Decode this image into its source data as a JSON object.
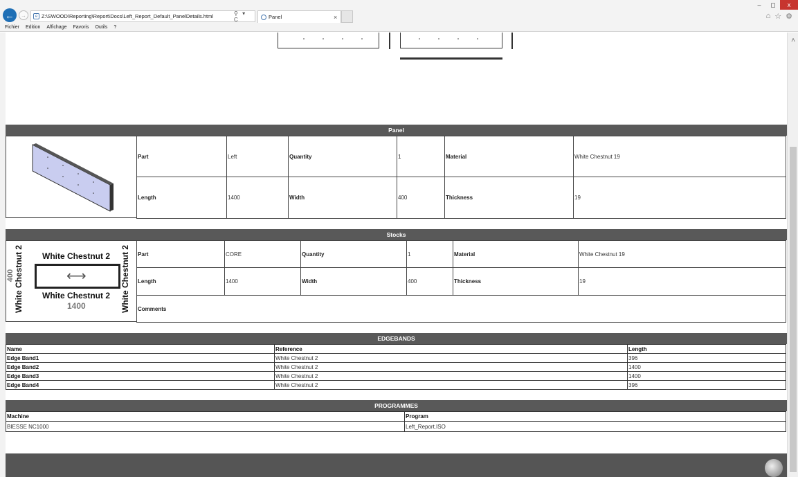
{
  "browser": {
    "url": "Z:\\SWOOD\\Reporting\\Report\\Docs\\Left_Report_Default_PanelDetails.html",
    "address_tools": "⚲ ▾ C",
    "tab_title": "Panel",
    "tab_close": "×",
    "window_controls": [
      "–",
      "◻",
      "x"
    ],
    "toolbar_icons": [
      "⌂",
      "☆",
      "⚙"
    ]
  },
  "menu": [
    "Fichier",
    "Edition",
    "Affichage",
    "Favoris",
    "Outils",
    "?"
  ],
  "panel": {
    "header": "Panel",
    "rows": [
      {
        "l1": "Part",
        "v1": "Left",
        "l2": "Quantity",
        "v2": "1",
        "l3": "Material",
        "v3": "White Chestnut 19"
      },
      {
        "l1": "Length",
        "v1": "1400",
        "l2": "Width",
        "v2": "400",
        "l3": "Thickness",
        "v3": "19"
      }
    ]
  },
  "stocks": {
    "header": "Stocks",
    "rows": [
      {
        "l1": "Part",
        "v1": "CORE",
        "l2": "Quantity",
        "v2": "1",
        "l3": "Material",
        "v3": "White Chestnut 19"
      },
      {
        "l1": "Length",
        "v1": "1400",
        "l2": "Width",
        "v2": "400",
        "l3": "Thickness",
        "v3": "19"
      }
    ],
    "comments_label": "Comments",
    "drawing": {
      "top": "White Chestnut 2",
      "bottom": "White Chestnut 2",
      "left": "White Chestnut 2",
      "right": "White Chestnut 2",
      "width_dim": "400",
      "length_dim": "1400",
      "arrow": "⟷"
    }
  },
  "edgebands": {
    "header": "EDGEBANDS",
    "columns": [
      "Name",
      "Reference",
      "Length"
    ],
    "rows": [
      [
        "Edge Band1",
        "White Chestnut 2",
        "396"
      ],
      [
        "Edge Band2",
        "White Chestnut 2",
        "1400"
      ],
      [
        "Edge Band3",
        "White Chestnut 2",
        "1400"
      ],
      [
        "Edge Band4",
        "White Chestnut 2",
        "396"
      ]
    ]
  },
  "programmes": {
    "header": "PROGRAMMES",
    "columns": [
      "Machine",
      "Program"
    ],
    "rows": [
      [
        "BIESSE NC1000",
        "Left_Report.ISO"
      ]
    ]
  },
  "scrollbar": {
    "up_arrow": "˄"
  }
}
